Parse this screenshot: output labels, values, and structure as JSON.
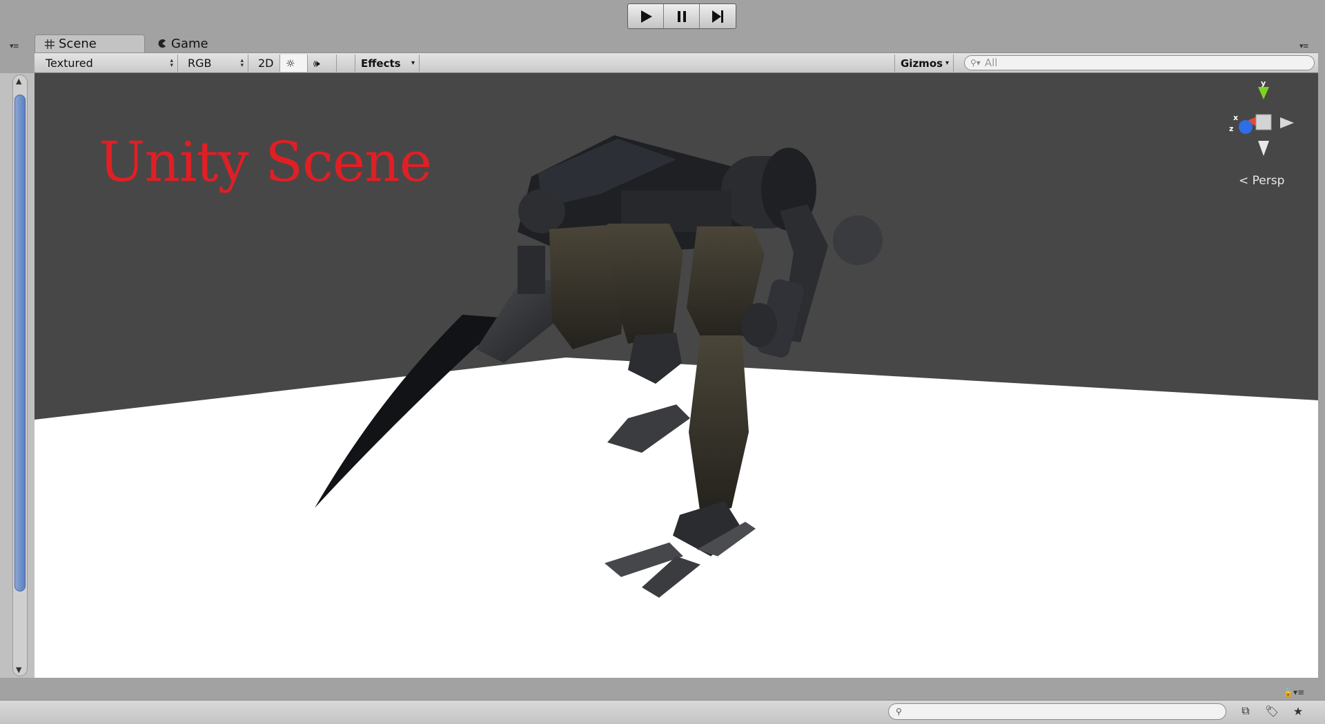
{
  "tabs": [
    {
      "label": "Scene",
      "icon": "grid-hash-icon"
    },
    {
      "label": "Game",
      "icon": "pacman-icon"
    }
  ],
  "toolbar": {
    "draw_mode": "Textured",
    "render_mode": "RGB",
    "mode_2d": "2D",
    "effects": "Effects",
    "gizmos": "Gizmos",
    "search_placeholder": "All"
  },
  "viewport": {
    "overlay_title": "Unity Scene",
    "projection": "Persp",
    "gizmo_axes": {
      "x": "x",
      "y": "y",
      "z": "z"
    },
    "colors": {
      "background": "#474747",
      "floor": "#ffffff",
      "title": "#e01f25"
    }
  },
  "bottom": {
    "search_placeholder": ""
  }
}
